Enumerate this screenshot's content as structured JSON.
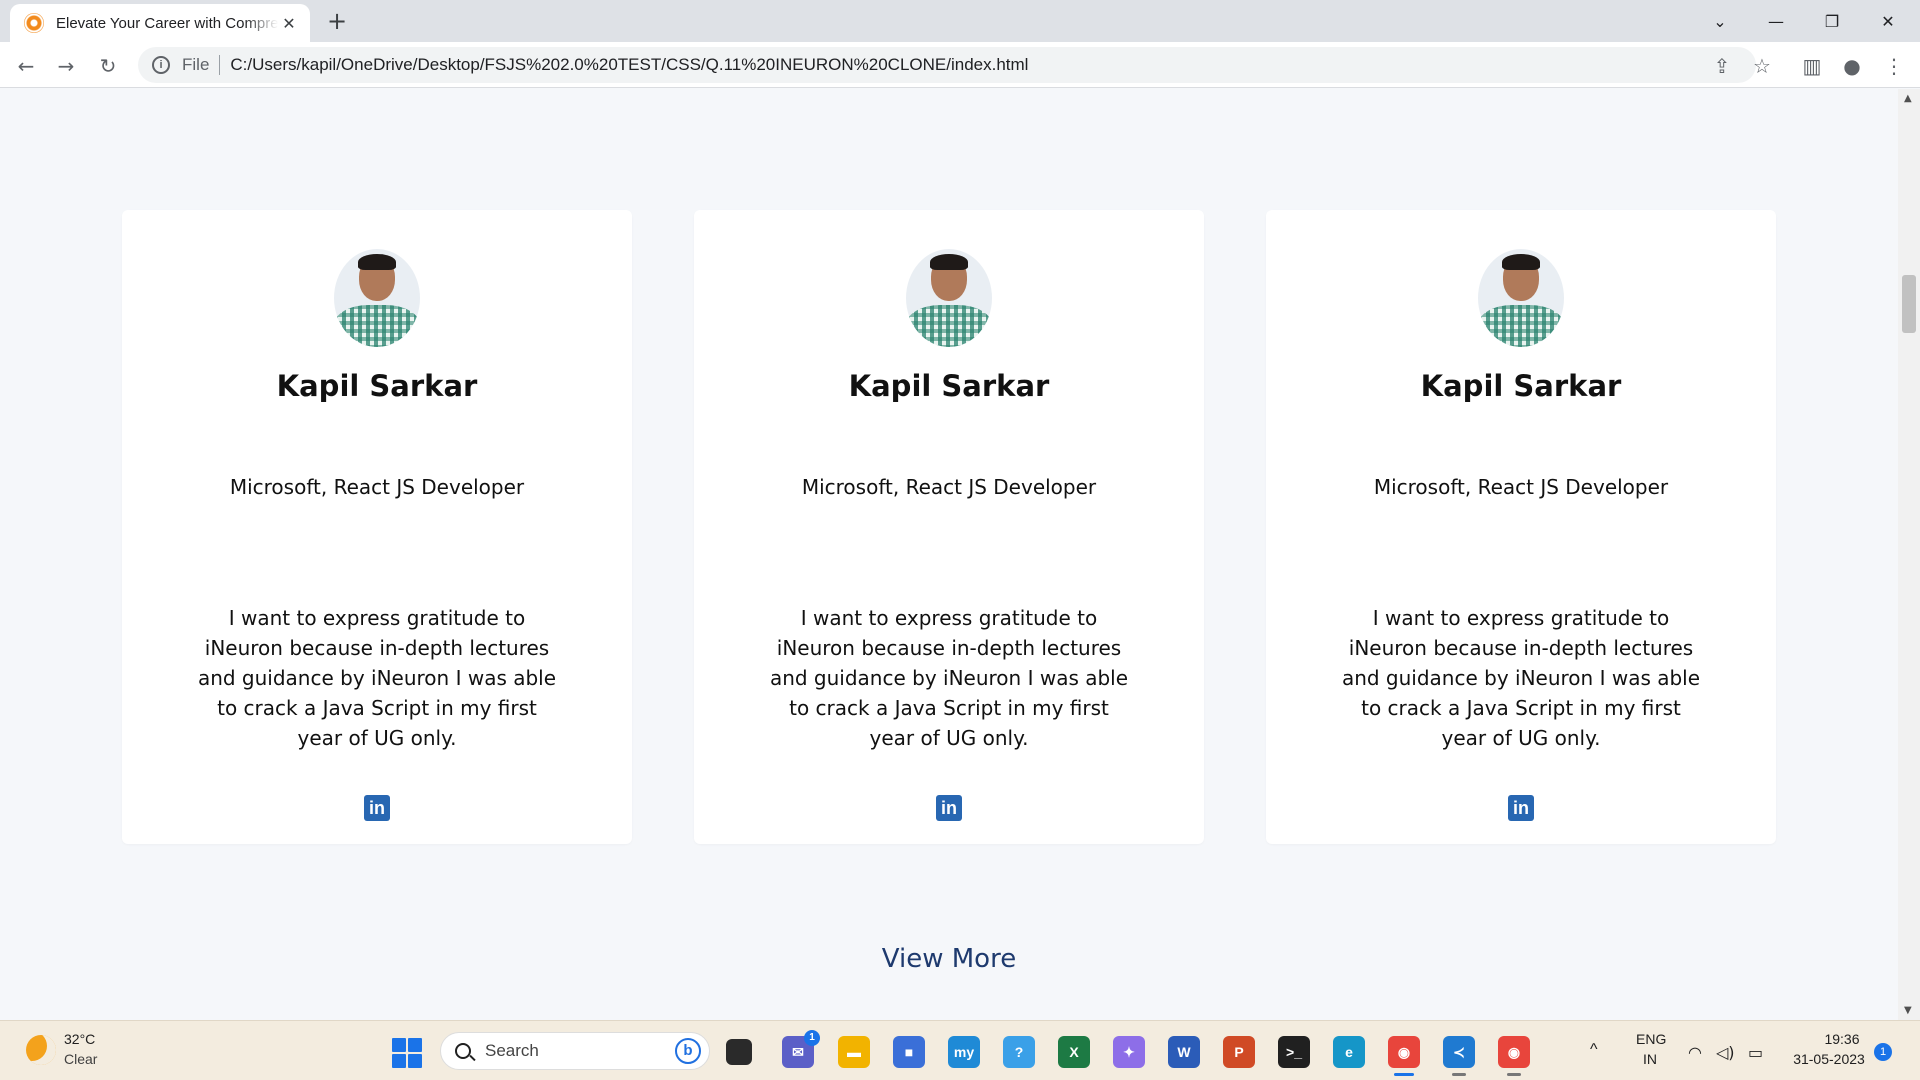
{
  "browser": {
    "tab_title": "Elevate Your Career with Comprehensive Courses",
    "tab_close": "✕",
    "new_tab": "+",
    "scheme": "File",
    "url": "C:/Users/kapil/OneDrive/Desktop/FSJS%202.0%20TEST/CSS/Q.11%20INEURON%20CLONE/index.html",
    "controls": {
      "dropdown": "⌄",
      "minimize": "—",
      "restore": "❐",
      "close": "✕"
    },
    "nav": {
      "back": "←",
      "forward": "→",
      "reload": "↻"
    },
    "toolbar_icons": {
      "share": "⇪",
      "bookmark": "☆",
      "sidepanel": "▥",
      "profile": "●",
      "menu": "⋮"
    }
  },
  "cards": [
    {
      "name": "Kapil Sarkar",
      "role": "Microsoft, React JS Developer",
      "quote": "I want to express gratitude to iNeuron because in-depth lectures and guidance by iNeuron I was able to crack a Java Script in my first year of UG only.",
      "social": "in"
    },
    {
      "name": "Kapil Sarkar",
      "role": "Microsoft, React JS Developer",
      "quote": "I want to express gratitude to iNeuron because in-depth lectures and guidance by iNeuron I was able to crack a Java Script in my first year of UG only.",
      "social": "in"
    },
    {
      "name": "Kapil Sarkar",
      "role": "Microsoft, React JS Developer",
      "quote": "I want to express gratitude to iNeuron because in-depth lectures and guidance by iNeuron I was able to crack a Java Script in my first year of UG only.",
      "social": "in"
    }
  ],
  "view_more": "View More",
  "taskbar": {
    "weather_temp": "32°C",
    "weather_desc": "Clear",
    "search_label": "Search",
    "bing": "b",
    "teams_badge": "1",
    "apps": [
      {
        "name": "file-explorer",
        "label": "▬",
        "color": "#f2b300"
      },
      {
        "name": "microsoft-store",
        "label": "■",
        "color": "#3a6fd8"
      },
      {
        "name": "mylo-app",
        "label": "my",
        "color": "#1f8ad6"
      },
      {
        "name": "help-app",
        "label": "?",
        "color": "#3aa0e8"
      },
      {
        "name": "excel",
        "label": "X",
        "color": "#1d7a44"
      },
      {
        "name": "copilot-app",
        "label": "✦",
        "color": "#8d6ee8"
      },
      {
        "name": "word",
        "label": "W",
        "color": "#2b5cb8"
      },
      {
        "name": "powerpoint",
        "label": "P",
        "color": "#d04a25"
      },
      {
        "name": "terminal",
        "label": ">_",
        "color": "#202020"
      },
      {
        "name": "edge",
        "label": "e",
        "color": "#1596c8"
      },
      {
        "name": "chrome",
        "label": "◉",
        "color": "#e8453c"
      },
      {
        "name": "vscode",
        "label": "≺",
        "color": "#1f7ad1"
      },
      {
        "name": "chrome-2",
        "label": "◉",
        "color": "#e8453c"
      }
    ],
    "chevron": "^",
    "lang_top": "ENG",
    "lang_bottom": "IN",
    "wifi": "◠",
    "volume": "◁)",
    "battery": "▭",
    "time": "19:36",
    "date": "31-05-2023",
    "notification_count": "1"
  }
}
